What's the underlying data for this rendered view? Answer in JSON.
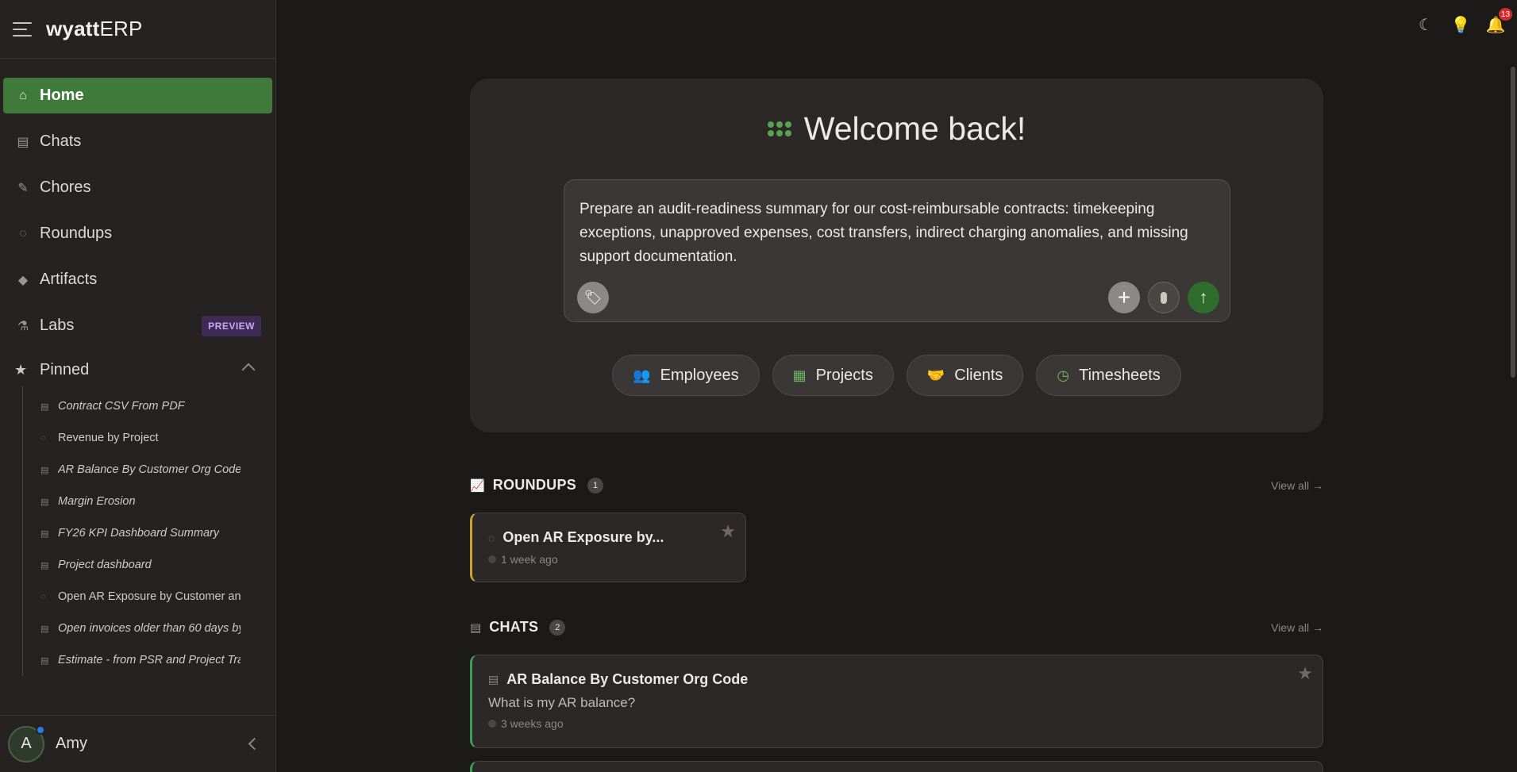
{
  "app": {
    "logo_bold": "wyatt",
    "logo_light": "ERP"
  },
  "nav": {
    "home": "Home",
    "chats": "Chats",
    "chores": "Chores",
    "roundups": "Roundups",
    "artifacts": "Artifacts",
    "labs": "Labs",
    "labs_badge": "PREVIEW",
    "pinned": "Pinned"
  },
  "pinned": [
    "Contract CSV From PDF",
    "Revenue by Project",
    "AR Balance By Customer Org Code",
    "Margin Erosion",
    "FY26 KPI Dashboard Summary",
    "Project dashboard",
    "Open AR Exposure by Customer and",
    "Open invoices older than 60 days by",
    "Estimate - from PSR and Project Tra"
  ],
  "user": {
    "initial": "A",
    "name": "Amy"
  },
  "topbar": {
    "notification_count": "13"
  },
  "welcome": {
    "title": "Welcome back!",
    "prompt": "Prepare an audit-readiness summary for our cost-reimbursable contracts: timekeeping exceptions, unapproved expenses, cost transfers, indirect charging anomalies, and missing support documentation."
  },
  "chips": [
    "Employees",
    "Projects",
    "Clients",
    "Timesheets"
  ],
  "roundups": {
    "title": "ROUNDUPS",
    "count": "1",
    "view_all": "View all →",
    "items": [
      {
        "title": "Open AR Exposure by...",
        "time": "1 week ago"
      }
    ]
  },
  "chats": {
    "title": "CHATS",
    "count": "2",
    "view_all": "View all →",
    "items": [
      {
        "title": "AR Balance By Customer Org Code",
        "subtitle": "What is my AR balance?",
        "time": "3 weeks ago"
      }
    ]
  },
  "colors": {
    "accent_green": "#3f7a3a",
    "roundup_border": "#c9a431",
    "chat_border": "#3a9d56",
    "preview_badge": "#3d2a55"
  }
}
